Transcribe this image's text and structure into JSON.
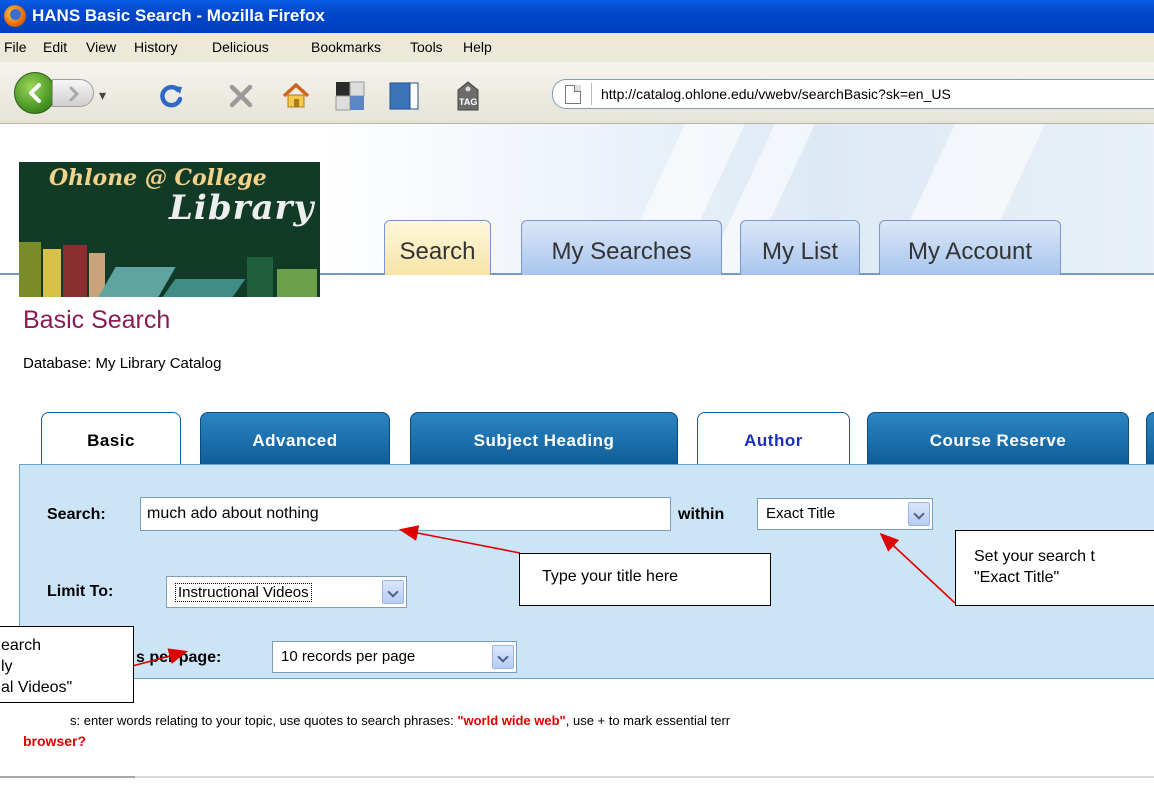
{
  "window": {
    "title": "HANS Basic Search - Mozilla Firefox"
  },
  "menu": [
    "File",
    "Edit",
    "View",
    "History",
    "Delicious",
    "Bookmarks",
    "Tools",
    "Help"
  ],
  "toolbar": {
    "url": "http://catalog.ohlone.edu/vwebv/searchBasic?sk=en_US",
    "tag_label": "TAG"
  },
  "logo": {
    "line1": "Ohlone @ College",
    "line2": "Library"
  },
  "top_tabs": [
    "Search",
    "My Searches",
    "My List",
    "My Account"
  ],
  "page": {
    "title": "Basic Search",
    "database": "Database: My Library Catalog"
  },
  "search_tabs": [
    "Basic",
    "Advanced",
    "Subject Heading",
    "Author",
    "Course Reserve"
  ],
  "form": {
    "search_label": "Search:",
    "search_value": "much ado about nothing",
    "within_label": "within",
    "within_value": "Exact Title",
    "limit_label": "Limit To:",
    "limit_value": "Instructional Videos",
    "per_page_label": "s per page:",
    "per_page_value": "10 records per page"
  },
  "tips": {
    "prefix": "s: enter words relating to your topic, use quotes to search phrases: ",
    "example": "\"world wide web\"",
    "suffix": ", use + to mark essential terr",
    "browser": "browser?"
  },
  "callouts": {
    "title_tip": "Type your title here",
    "exact_line1": "Set your search t",
    "exact_line2": "\"Exact Title\"",
    "limit_line1": "earch",
    "limit_line2": "ly",
    "limit_line3": "al Videos\""
  },
  "colors": {
    "title_bar": "#0047c9",
    "page_title": "#8b1a55",
    "tab_dark": "#0f5d98",
    "panel": "#cbe5f7",
    "arrow": "#e00000"
  }
}
